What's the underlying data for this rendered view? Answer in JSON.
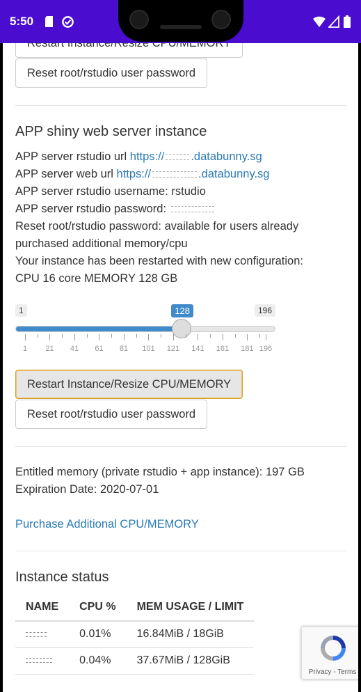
{
  "status_bar": {
    "time": "5:50"
  },
  "buttons": {
    "restart_resize_top": "Restart Instance/Resize CPU/MEMORY",
    "reset_password_top": "Reset root/rstudio user password",
    "restart_resize": "Restart Instance/Resize CPU/MEMORY",
    "reset_password": "Reset root/rstudio user password"
  },
  "app_section": {
    "title": "APP shiny web server instance",
    "rstudio_url_label": "APP server rstudio url",
    "rstudio_url_prefix": "https://",
    "rstudio_url_suffix": ".databunny.sg",
    "web_url_label": "APP server web url",
    "web_url_prefix": "https://",
    "web_url_suffix": ".databunny.sg",
    "username_line": "APP server rstudio username: rstudio",
    "password_label": "APP server rstudio password:",
    "reset_info_1": "Reset root/rstudio password: available for users already",
    "reset_info_2": "purchased additional memory/cpu",
    "restart_info_1": "Your instance has been restarted with new configuration:",
    "restart_info_2": "CPU 16 core MEMORY 128 GB"
  },
  "slider": {
    "min_label": "1",
    "value_label": "128",
    "max_label": "196",
    "min": 1,
    "max": 196,
    "value": 128,
    "tick_labels": [
      "1",
      "21",
      "41",
      "61",
      "81",
      "101",
      "121",
      "141",
      "161",
      "181",
      "196"
    ]
  },
  "entitlement": {
    "memory_line": "Entitled memory (private rstudio + app instance): 197 GB",
    "expiration_line": "Expiration Date: 2020-07-01",
    "purchase_link": "Purchase Additional CPU/MEMORY"
  },
  "instance_status": {
    "title": "Instance status",
    "columns": [
      "NAME",
      "CPU %",
      "MEM USAGE / LIMIT"
    ],
    "rows": [
      {
        "cpu": "0.01%",
        "mem": "16.84MiB / 18GiB"
      },
      {
        "cpu": "0.04%",
        "mem": "37.67MiB / 128GiB"
      }
    ]
  },
  "recaptcha": {
    "terms": "Privacy - Terms"
  },
  "colors": {
    "status_bar": "#4a0ccf",
    "link": "#2a7ab5",
    "slider_fill": "#428bca",
    "active_border": "#d89d2b"
  }
}
